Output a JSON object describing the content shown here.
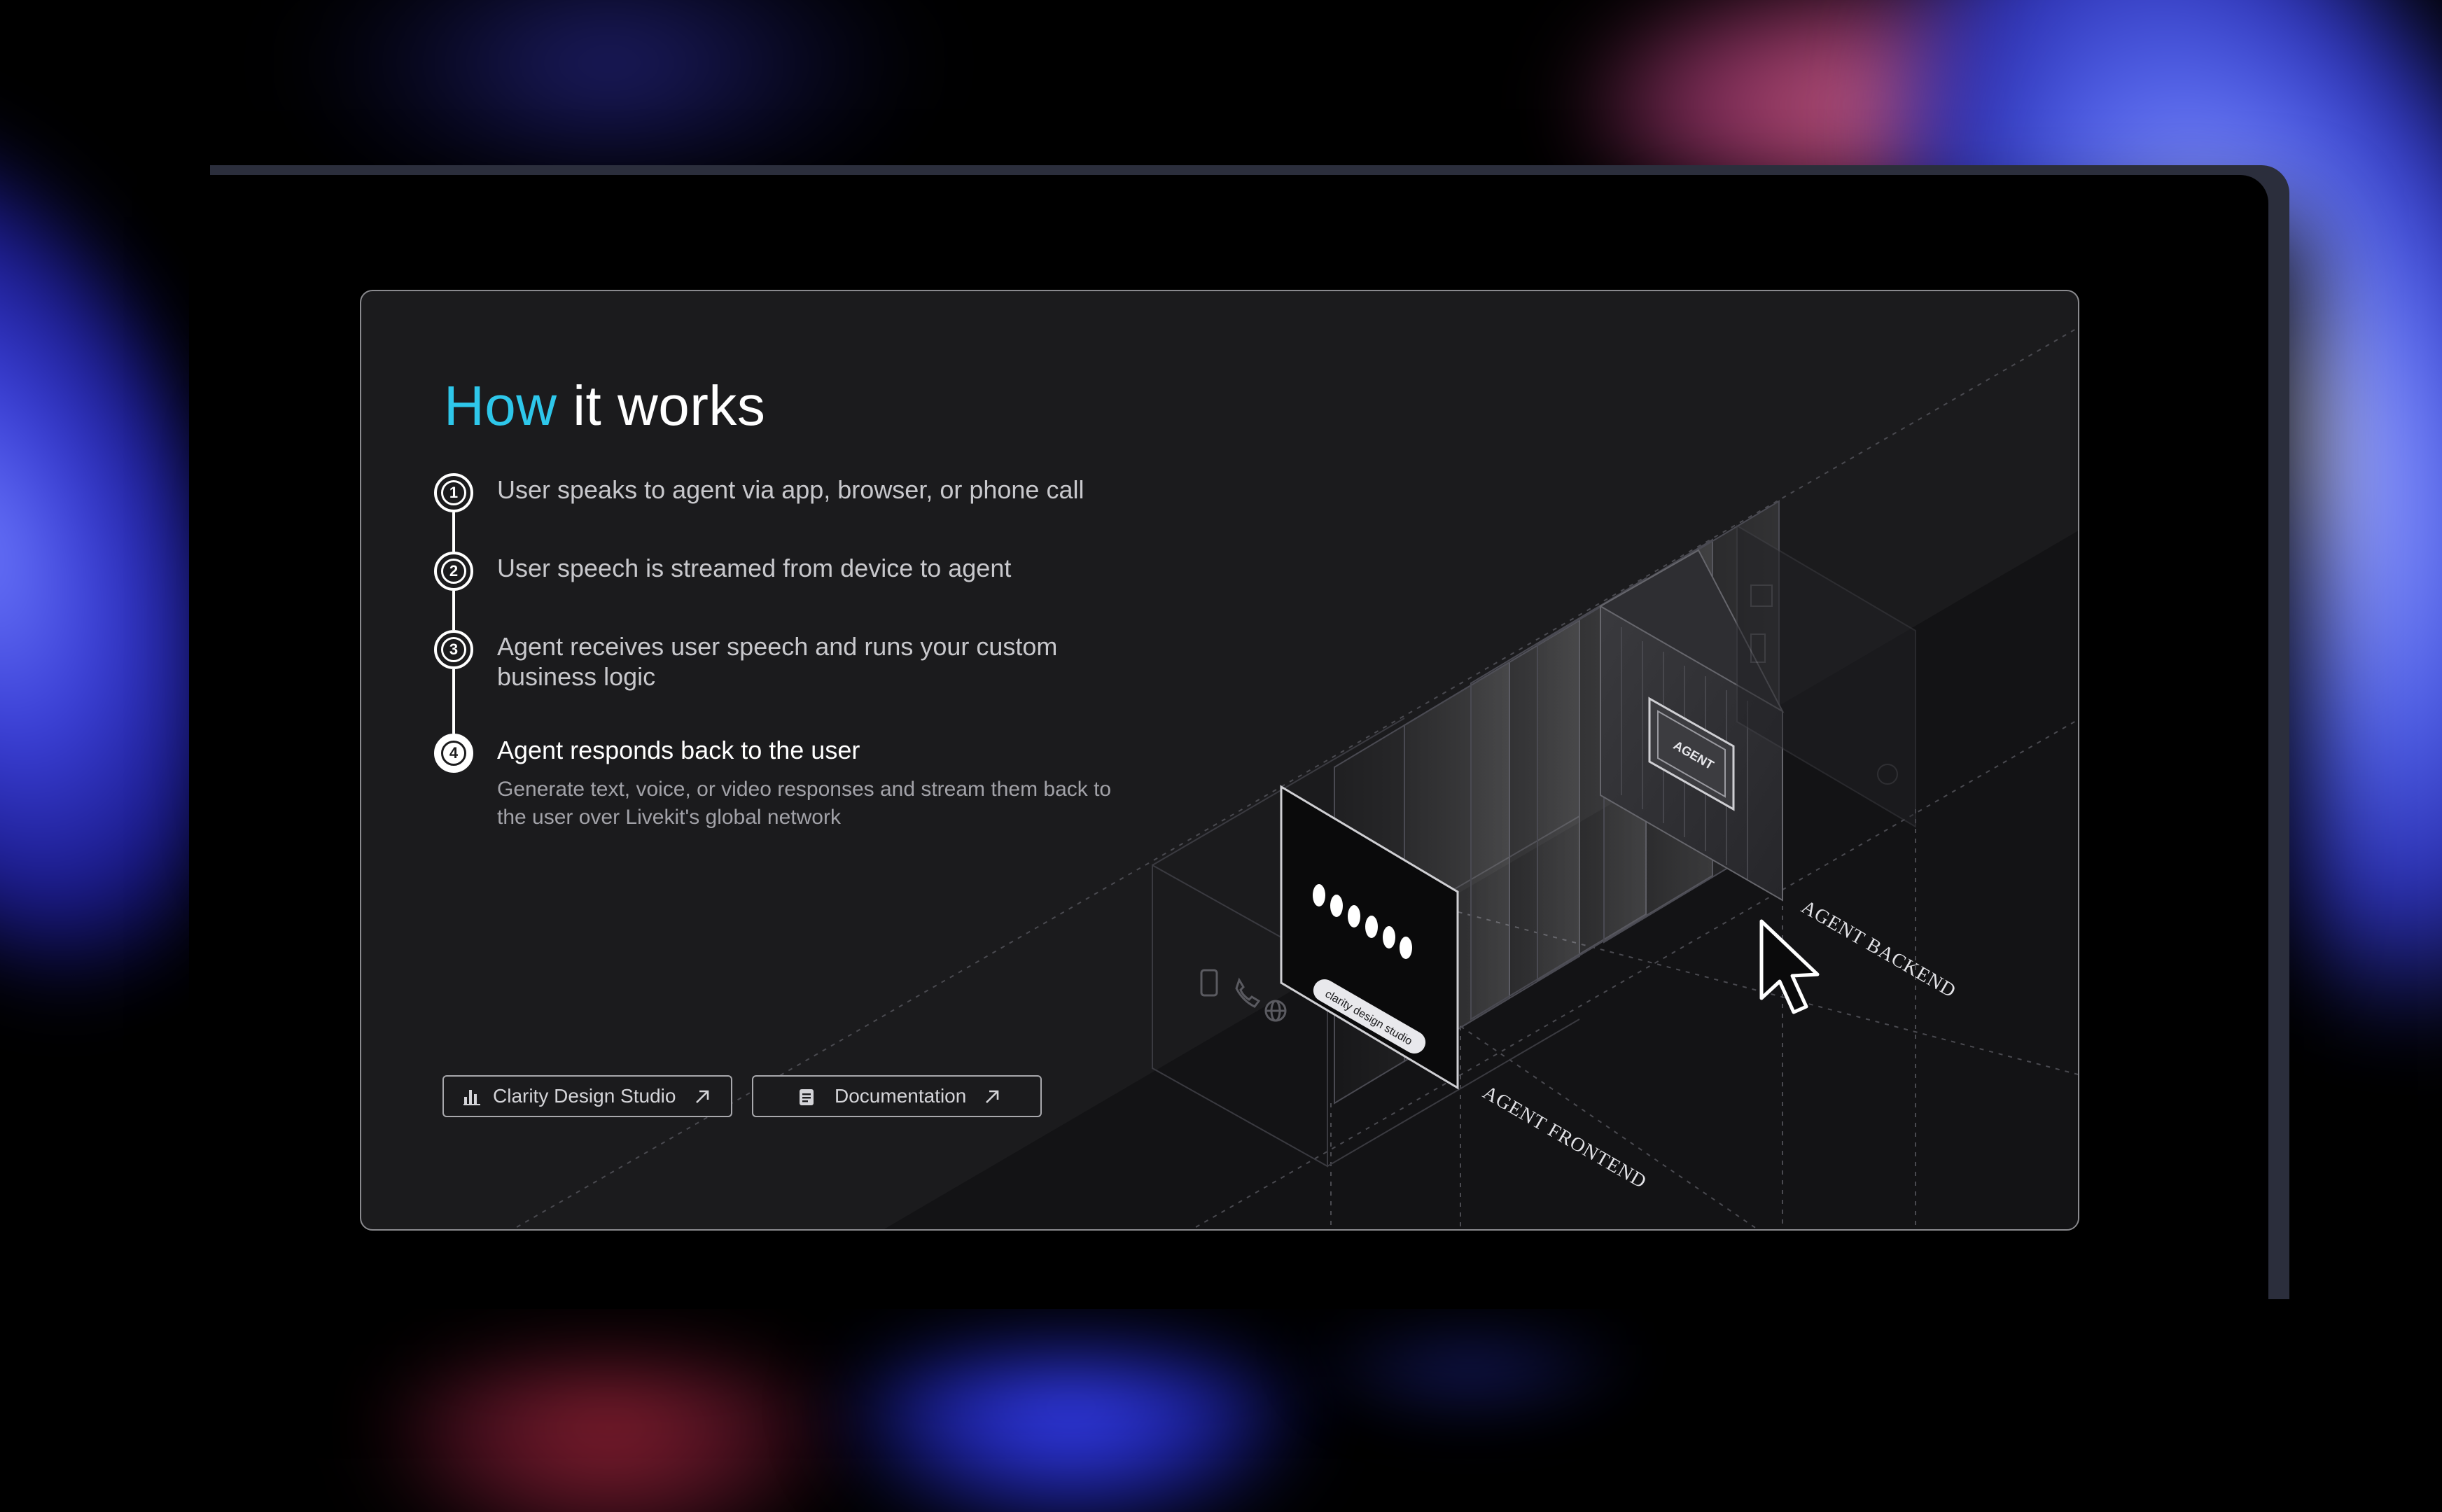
{
  "slide": {
    "title_accent": "How",
    "title_rest": "it works"
  },
  "steps": [
    {
      "number": "1",
      "text": "User speaks to agent via app, browser, or phone call",
      "active": false
    },
    {
      "number": "2",
      "text": "User speech is streamed from device to agent",
      "active": false
    },
    {
      "number": "3",
      "text": "Agent receives user speech and runs your custom business logic",
      "active": false
    },
    {
      "number": "4",
      "text": "Agent responds back to the user",
      "description": "Generate text, voice, or video responses and stream them back to the user over Livekit's global network",
      "active": true
    }
  ],
  "buttons": [
    {
      "label": "Clarity Design Studio",
      "icon": "bar-chart-icon",
      "trailing_icon": "arrow-up-right-icon"
    },
    {
      "label": "Documentation",
      "icon": "document-icon",
      "trailing_icon": "arrow-up-right-icon"
    }
  ],
  "illustration": {
    "frontend_label": "AGENT FRONTEND",
    "backend_label": "AGENT BACKEND",
    "chip_label": "AGENT",
    "pill_label": "clarity design studio",
    "device_icons": [
      "phone-icon",
      "call-icon",
      "globe-icon"
    ]
  },
  "colors": {
    "accent": "#2ec7ea",
    "card_background": "#1b1b1d",
    "text_primary": "#ffffff",
    "text_secondary": "#c8c8cc"
  }
}
